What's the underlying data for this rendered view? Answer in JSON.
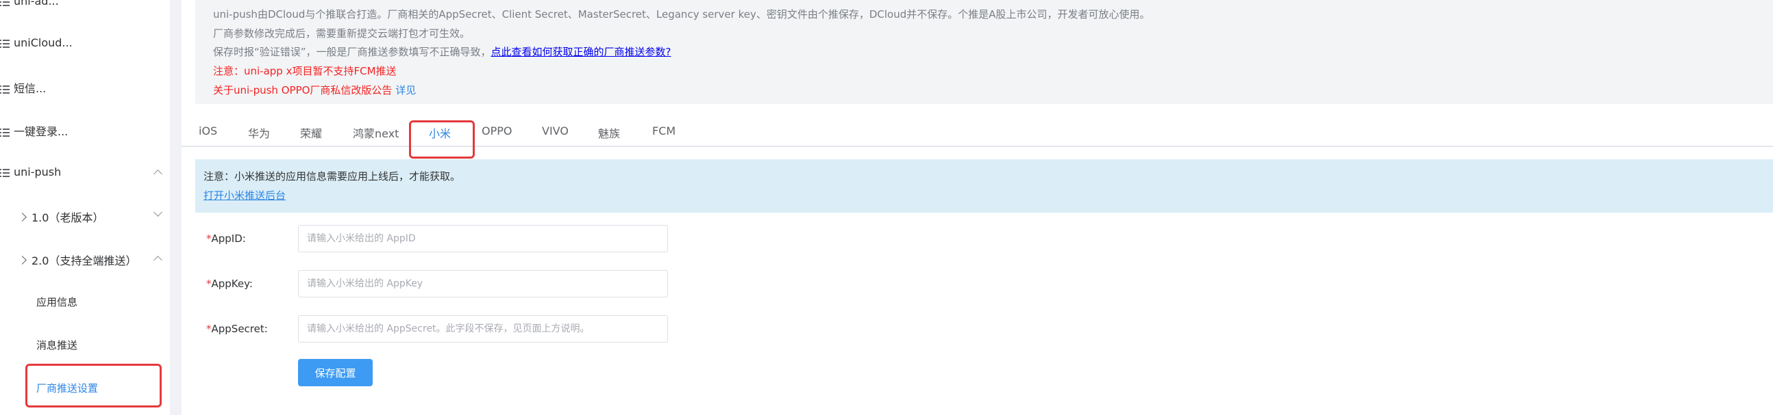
{
  "sidebar": {
    "items": [
      {
        "label": "uni-ad..."
      },
      {
        "label": "uniCloud..."
      },
      {
        "label": "短信..."
      },
      {
        "label": "一键登录..."
      },
      {
        "label": "uni-push"
      },
      {
        "label": "1.0（老版本）"
      },
      {
        "label": "2.0（支持全端推送）"
      },
      {
        "label": "应用信息"
      },
      {
        "label": "消息推送"
      },
      {
        "label": "厂商推送设置"
      }
    ]
  },
  "notice": {
    "line1": "uni-push由DCloud与个推联合打造。厂商相关的AppSecret、Client Secret、MasterSecret、Legancy server key、密钥文件由个推保存，DCloud并不保存。个推是A股上市公司，开发者可放心使用。",
    "line2": "厂商参数修改完成后，需要重新提交云端打包才可生效。",
    "line3_prefix": "保存时报“验证错误”，一般是厂商推送参数填写不正确导致，",
    "line3_link": "点此查看如何获取正确的厂商推送参数?",
    "line4": "注意：uni-app x项目暂不支持FCM推送",
    "line5_prefix": "关于uni-push OPPO厂商私信改版公告",
    "line5_link": "详见"
  },
  "tabs": [
    "iOS",
    "华为",
    "荣耀",
    "鸿蒙next",
    "小米",
    "OPPO",
    "VIVO",
    "魅族",
    "FCM"
  ],
  "active_tab": "小米",
  "info": {
    "text": "注意：小米推送的应用信息需要应用上线后，才能获取。",
    "link": "打开小米推送后台"
  },
  "form": {
    "appid_label": "AppID:",
    "appid_placeholder": "请输入小米给出的 AppID",
    "appkey_label": "AppKey:",
    "appkey_placeholder": "请输入小米给出的 AppKey",
    "appsecret_label": "AppSecret:",
    "appsecret_placeholder": "请输入小米给出的 AppSecret。此字段不保存，见页面上方说明。",
    "required_mark": "*",
    "save_label": "保存配置"
  },
  "colors": {
    "accent": "#2b85e4",
    "warning": "#f52222",
    "highlight_box": "#e4393c",
    "info_bg": "#dbeef7"
  }
}
